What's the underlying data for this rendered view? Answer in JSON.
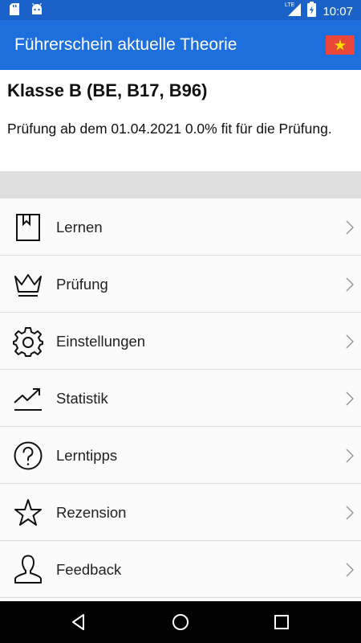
{
  "status_bar": {
    "time": "10:07",
    "network": "LTE",
    "icons": [
      "sd-card-icon",
      "android-icon",
      "signal-icon",
      "battery-charging-icon"
    ]
  },
  "app_bar": {
    "title": "Führerschein aktuelle Theorie",
    "flag_icon": "vietnam-flag-icon"
  },
  "header": {
    "class_title": "Klasse B (BE, B17, B96)",
    "exam_info": "Prüfung ab dem 01.04.2021 0.0% fit für die Prüfung."
  },
  "menu": {
    "items": [
      {
        "label": "Lernen",
        "icon": "book-icon"
      },
      {
        "label": "Prüfung",
        "icon": "crown-icon"
      },
      {
        "label": "Einstellungen",
        "icon": "gear-icon"
      },
      {
        "label": "Statistik",
        "icon": "trend-chart-icon"
      },
      {
        "label": "Lerntipps",
        "icon": "question-icon"
      },
      {
        "label": "Rezension",
        "icon": "star-icon"
      },
      {
        "label": "Feedback",
        "icon": "person-icon"
      }
    ]
  },
  "nav_bar": {
    "icons": [
      "back-icon",
      "home-icon",
      "recents-icon"
    ]
  },
  "colors": {
    "status_bar": "#1a62c9",
    "app_bar": "#1e6fde",
    "flag_red": "#e8473a",
    "flag_star": "#ffde00"
  }
}
